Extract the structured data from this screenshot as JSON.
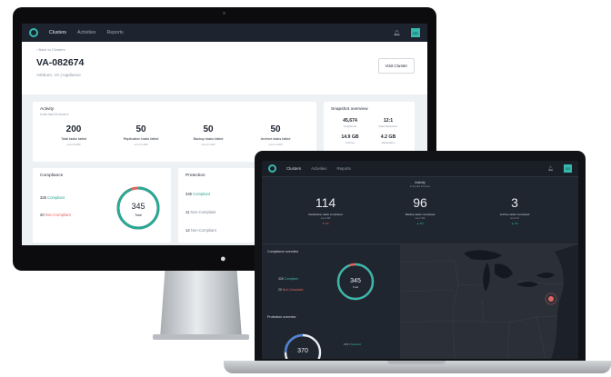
{
  "nav": {
    "links": [
      "Clusters",
      "Activities",
      "Reports"
    ],
    "avatar_initials": "DD"
  },
  "desktop": {
    "back_link": "Back to Clusters",
    "title": "VA-082674",
    "subtitle": "Ashburn, VA | Appliance",
    "visit_button": "Visit Cluster",
    "activity": {
      "title": "Activity",
      "sub": "in the last 24 hours",
      "stats": [
        {
          "value": "200",
          "label": "Total tasks failed",
          "of": "out of 4,000"
        },
        {
          "value": "50",
          "label": "Replication tasks failed",
          "of": "out of 1,000"
        },
        {
          "value": "50",
          "label": "Backup tasks failed",
          "of": "out of 1,000"
        },
        {
          "value": "50",
          "label": "Archive tasks failed",
          "of": "out of 1,000"
        }
      ]
    },
    "snapshot": {
      "title": "Snapshot overview",
      "items": [
        {
          "value": "45,674",
          "label": "Snapshots"
        },
        {
          "value": "12:1",
          "label": "Data Reduction"
        },
        {
          "value": "14.9 GB",
          "label": "Archive"
        },
        {
          "value": "4.2 GB",
          "label": "Replication"
        }
      ],
      "next_section": "Capacity"
    },
    "compliance": {
      "title": "Compliance",
      "compliant_count": "325",
      "compliant_label": "Compliant",
      "noncompliant_count": "20",
      "noncompliant_label": "Non-Compliant",
      "total": "345",
      "total_label": "Total",
      "compliant_fraction": 0.94
    },
    "protection": {
      "title": "Protection",
      "rows": [
        {
          "count": "345",
          "label": "Compliant"
        },
        {
          "count": "11",
          "label": "Non-Compliant"
        },
        {
          "count": "14",
          "label": "Non-Compliant"
        }
      ]
    }
  },
  "laptop": {
    "activity": {
      "title": "Activity",
      "sub": "in the last 24 hours",
      "stats": [
        {
          "value": "114",
          "label": "Replication tasks completed",
          "of": "out of 150",
          "trend": "▼ 2%"
        },
        {
          "value": "96",
          "label": "Backup tasks completed",
          "of": "out of 150",
          "trend": "▲ 4%"
        },
        {
          "value": "3",
          "label": "Archive tasks completed",
          "of": "out of 10",
          "trend": "▲ 1%"
        }
      ]
    },
    "compliance": {
      "title": "Compliance overview",
      "compliant_count": "325",
      "compliant_label": "Compliant",
      "noncompliant_count": "20",
      "noncompliant_label": "Non-Compliant",
      "total": "345",
      "total_label": "Total",
      "compliant_fraction": 0.94
    },
    "protection": {
      "title": "Protection overview",
      "total": "370",
      "row_count": "170",
      "row_label": "Protected"
    }
  },
  "colors": {
    "accent": "#37b8ad",
    "danger": "#e0645f",
    "nav_bg": "#1d2430"
  }
}
